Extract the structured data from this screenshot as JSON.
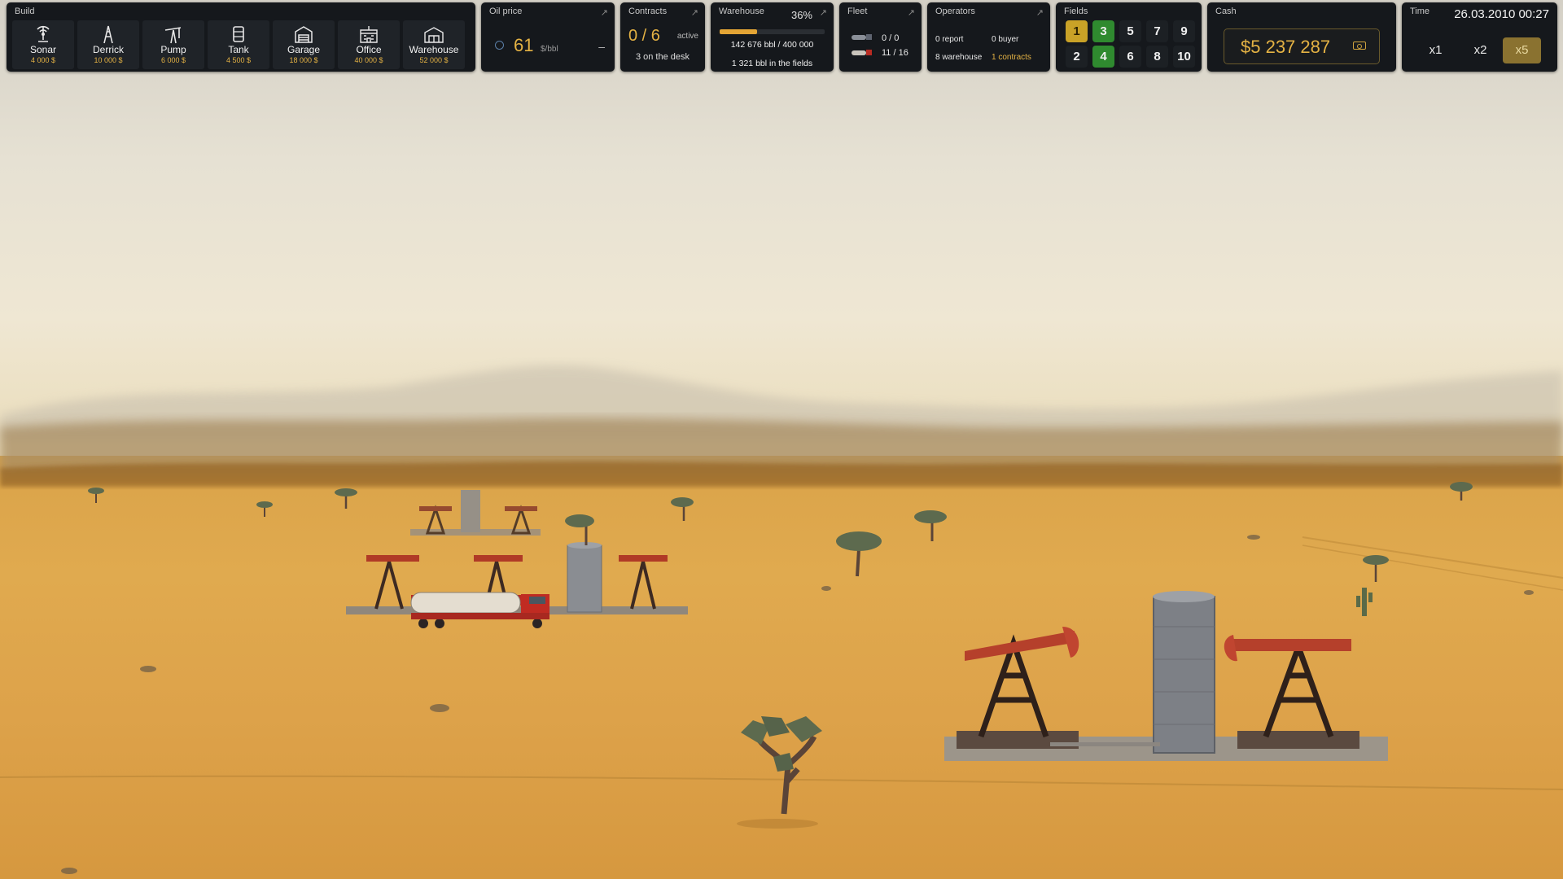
{
  "build": {
    "title": "Build",
    "items": [
      {
        "name": "Sonar",
        "price": "4 000 $",
        "icon": "sonar-icon"
      },
      {
        "name": "Derrick",
        "price": "10 000 $",
        "icon": "derrick-icon"
      },
      {
        "name": "Pump",
        "price": "6 000 $",
        "icon": "pump-icon"
      },
      {
        "name": "Tank",
        "price": "4 500 $",
        "icon": "tank-icon"
      },
      {
        "name": "Garage",
        "price": "18 000 $",
        "icon": "garage-icon"
      },
      {
        "name": "Office",
        "price": "40 000 $",
        "icon": "office-icon"
      },
      {
        "name": "Warehouse",
        "price": "52 000 $",
        "icon": "warehouse-icon"
      }
    ]
  },
  "oil_price": {
    "title": "Oil price",
    "value": "61",
    "unit": "$/bbl",
    "trend": "–"
  },
  "contracts": {
    "title": "Contracts",
    "count": "0 / 6",
    "status": "active",
    "desk": "3 on the desk"
  },
  "warehouse": {
    "title": "Warehouse",
    "percent": "36%",
    "fill_fraction": 0.36,
    "stock": "142 676 bbl / 400 000",
    "fields": "1 321 bbl in the fields"
  },
  "fleet": {
    "title": "Fleet",
    "row1": "0 / 0",
    "row2": "11 / 16"
  },
  "operators": {
    "title": "Operators",
    "report": "0 report",
    "buyer": "0 buyer",
    "warehouse": "8 warehouse",
    "contracts": "1 contracts"
  },
  "fields": {
    "title": "Fields",
    "top": [
      {
        "label": "1",
        "state": "selected"
      },
      {
        "label": "3",
        "state": "owned"
      },
      {
        "label": "5",
        "state": "none"
      },
      {
        "label": "7",
        "state": "none"
      },
      {
        "label": "9",
        "state": "none"
      }
    ],
    "bottom": [
      {
        "label": "2",
        "state": "none"
      },
      {
        "label": "4",
        "state": "owned"
      },
      {
        "label": "6",
        "state": "none"
      },
      {
        "label": "8",
        "state": "none"
      },
      {
        "label": "10",
        "state": "none"
      }
    ]
  },
  "cash": {
    "title": "Cash",
    "amount": "$5 237 287"
  },
  "time": {
    "title": "Time",
    "datetime": "26.03.2010 00:27",
    "speeds": [
      "x1",
      "x2",
      "x5"
    ],
    "active_speed": "x5"
  },
  "colors": {
    "panel": "#15181c",
    "accent": "#e4b244",
    "selected_field": "#c9a227",
    "owned_field": "#2f8a2f",
    "tank_truck": "#b82b22"
  }
}
